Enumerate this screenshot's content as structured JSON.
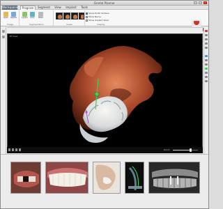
{
  "window": {
    "title": "Dental Planner"
  },
  "tabs": [
    {
      "label": "Workspace"
    },
    {
      "label": "Program"
    },
    {
      "label": "Segment"
    },
    {
      "label": "View"
    },
    {
      "label": "Implant"
    },
    {
      "label": "Tools"
    }
  ],
  "ribbon": {
    "groups": [
      {
        "label": "Image"
      },
      {
        "label": "Segmentation"
      },
      {
        "label": "Views"
      },
      {
        "label": "Display"
      }
    ],
    "buttons": [
      {
        "label": "Open",
        "icon": "folder-icon"
      },
      {
        "label": "Segment",
        "icon": "segment-icon"
      },
      {
        "label": "Layers",
        "icon": "layers-icon"
      },
      {
        "label": "Scan",
        "icon": "scan-icon"
      },
      {
        "label": "Mesh",
        "icon": "mesh-icon"
      }
    ],
    "display_options": [
      {
        "label": "Show Tooth Surface",
        "checked": true
      },
      {
        "label": "Show Nerve",
        "checked": false
      },
      {
        "label": "Show Implant Shell",
        "checked": false
      }
    ]
  },
  "viewport": {
    "label": "3D View",
    "zoom_label": "Zoom",
    "zoom_level": 0.72
  },
  "colors": {
    "accent": "#c7362f",
    "selection": "#3d8fd6",
    "implant": "#3ccf52"
  }
}
